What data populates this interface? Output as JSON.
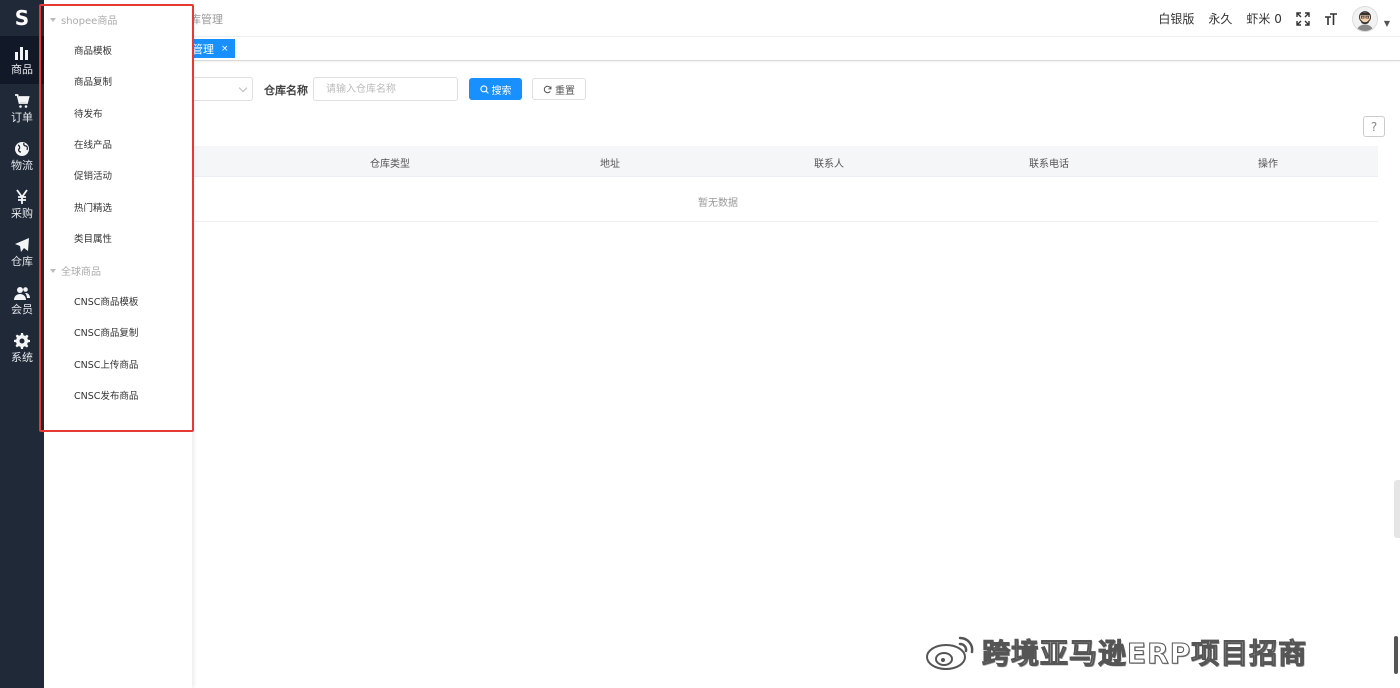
{
  "rail": {
    "logo": "S",
    "items": [
      {
        "label": "商品",
        "icon": "bar-chart-icon"
      },
      {
        "label": "订单",
        "icon": "cart-icon"
      },
      {
        "label": "物流",
        "icon": "globe-icon"
      },
      {
        "label": "采购",
        "icon": "yen-icon"
      },
      {
        "label": "仓库",
        "icon": "paper-plane-icon"
      },
      {
        "label": "会员",
        "icon": "users-icon"
      },
      {
        "label": "系统",
        "icon": "gear-icon"
      }
    ]
  },
  "header": {
    "breadcrumb": "库管理",
    "plan": "白银版",
    "duration": "永久",
    "credits": "虾米 0"
  },
  "tagbar": {
    "tag_label": "管理",
    "tag_close": "×"
  },
  "filter": {
    "warehouse_name_label": "仓库名称",
    "warehouse_name_placeholder": "请输入仓库名称",
    "search_label": "搜索",
    "reset_label": "重置",
    "help": "?"
  },
  "table": {
    "columns": [
      "仓库类型",
      "地址",
      "联系人",
      "联系电话",
      "操作"
    ],
    "empty_text": "暂无数据"
  },
  "flyout": {
    "group1_title": "shopee商品",
    "group1_items": [
      "商品模板",
      "商品复制",
      "待发布",
      "在线产品",
      "促销活动",
      "热门精选",
      "类目属性"
    ],
    "group2_title": "全球商品",
    "group2_items": [
      "CNSC商品模板",
      "CNSC商品复制",
      "CNSC上传商品",
      "CNSC发布商品"
    ]
  },
  "watermark": {
    "text": "跨境亚马逊ERP项目招商"
  },
  "colors": {
    "rail_bg": "#1f2937",
    "primary": "#1890ff",
    "highlight_border": "#e53935"
  }
}
